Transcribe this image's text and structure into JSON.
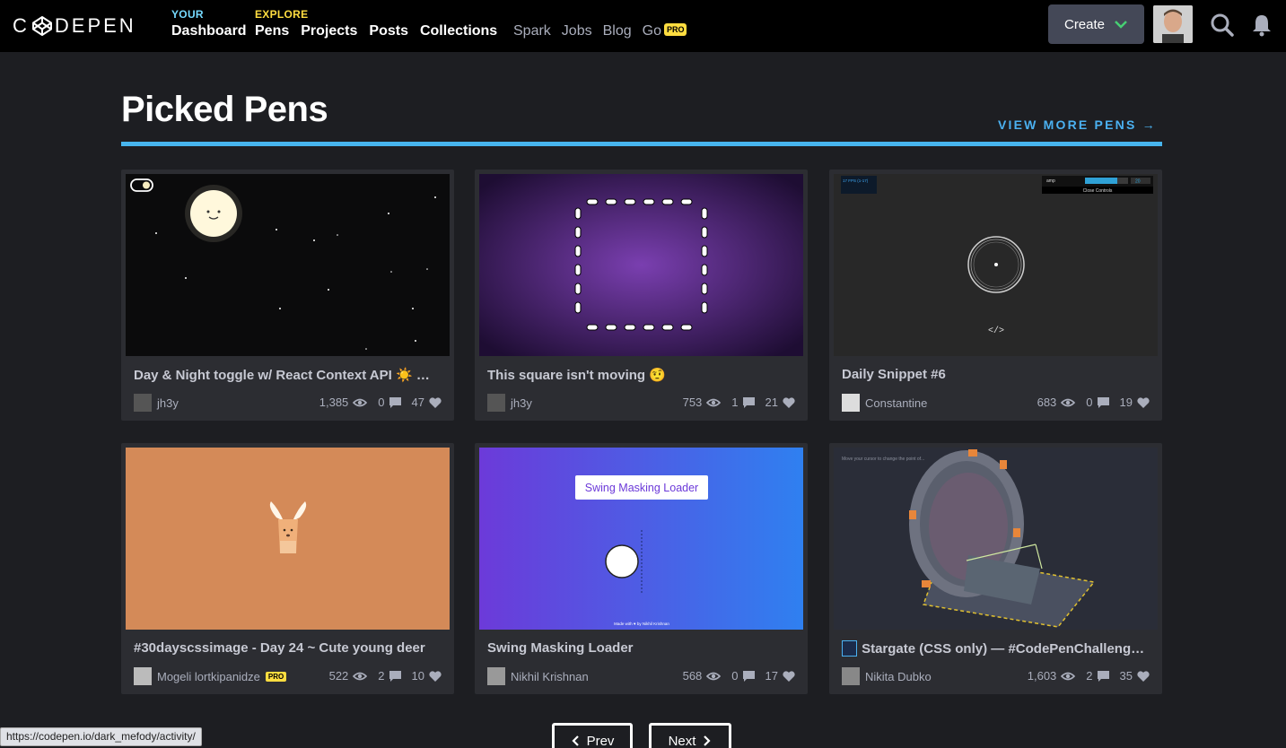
{
  "header": {
    "logo_text": "C DEPEN",
    "your_label": "YOUR",
    "dashboard_label": "Dashboard",
    "explore_label": "EXPLORE",
    "explore_links": [
      "Pens",
      "Projects",
      "Posts",
      "Collections"
    ],
    "secondary_links": [
      "Spark",
      "Jobs",
      "Blog",
      "Go"
    ],
    "pro_badge": "PRO",
    "create_label": "Create",
    "accent": "#47cf73"
  },
  "page": {
    "title": "Picked Pens",
    "view_more": "VIEW MORE PENS →",
    "accent": "#47b5ee"
  },
  "cards": [
    {
      "title": "Day & Night toggle w/ React Context API ☀️ 🌓😎",
      "author": "jh3y",
      "views": "1,385",
      "comments": "0",
      "likes": "47",
      "pro": false
    },
    {
      "title": "This square isn't moving 🤨",
      "author": "jh3y",
      "views": "753",
      "comments": "1",
      "likes": "21",
      "pro": false
    },
    {
      "title": "Daily Snippet #6",
      "author": "Constantine",
      "views": "683",
      "comments": "0",
      "likes": "19",
      "pro": false
    },
    {
      "title": "#30dayscssimage - Day 24 ~ Cute young deer",
      "author": "Mogeli lortkipanidze",
      "views": "522",
      "comments": "2",
      "likes": "10",
      "pro": true
    },
    {
      "title": "Swing Masking Loader",
      "author": "Nikhil Krishnan",
      "views": "568",
      "comments": "0",
      "likes": "17",
      "pro": false
    },
    {
      "title": "Stargate (CSS only) — #CodePenChallenge, W...",
      "author": "Nikita Dubko",
      "views": "1,603",
      "comments": "2",
      "likes": "35",
      "pro": false
    }
  ],
  "thumbs": {
    "snippet_fps": "17 FPS (1-17)",
    "snippet_control": "amp",
    "snippet_value": "20",
    "snippet_close": "Close Controls",
    "snippet_code": "</>",
    "loader_label": "Swing Masking Loader",
    "loader_credit": "Made with ♥ by Nikhil Krishnan",
    "stargate_hint": "Move your cursor to change the point of..."
  },
  "pagination": {
    "prev": "Prev",
    "next": "Next"
  },
  "status_url": "https://codepen.io/dark_mefody/activity/"
}
